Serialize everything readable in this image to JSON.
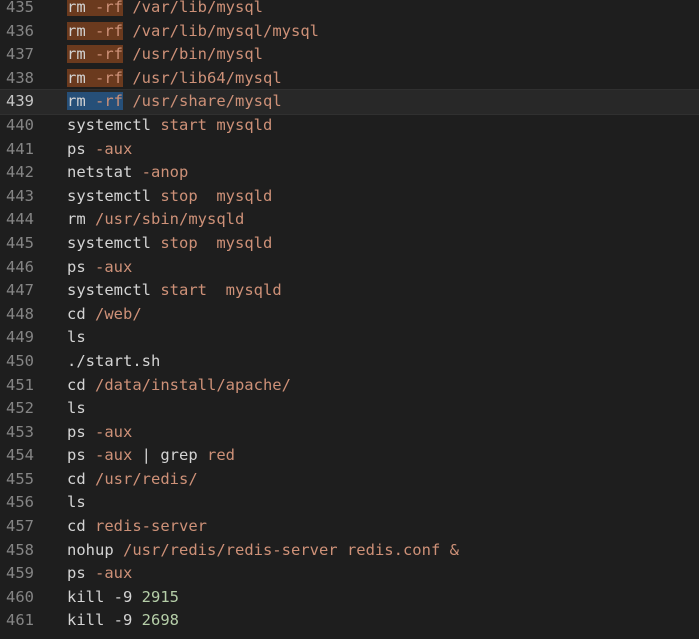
{
  "colors": {
    "background": "#1e1e1e",
    "line_number": "#858585",
    "command": "#d4d4d4",
    "argument": "#ce9178",
    "number": "#b5cea8",
    "selection_highlight": "#6b3a1e",
    "cursor_selection": "#264f78",
    "current_line": "#282828"
  },
  "editor": {
    "current_line": 439,
    "lines": [
      {
        "n": "435",
        "tokens": [
          {
            "t": "rm",
            "k": "cmd",
            "hl": true
          },
          {
            "t": " ",
            "k": "cmd",
            "hl": true
          },
          {
            "t": "-rf",
            "k": "arg",
            "hl": true
          },
          {
            "t": " /var/lib/mysql",
            "k": "arg"
          }
        ]
      },
      {
        "n": "436",
        "tokens": [
          {
            "t": "rm",
            "k": "cmd",
            "hl": true
          },
          {
            "t": " ",
            "k": "cmd",
            "hl": true
          },
          {
            "t": "-rf",
            "k": "arg",
            "hl": true
          },
          {
            "t": " /var/lib/mysql/mysql",
            "k": "arg"
          }
        ]
      },
      {
        "n": "437",
        "tokens": [
          {
            "t": "rm",
            "k": "cmd",
            "hl": true
          },
          {
            "t": " ",
            "k": "cmd",
            "hl": true
          },
          {
            "t": "-rf",
            "k": "arg",
            "hl": true
          },
          {
            "t": " /usr/bin/mysql",
            "k": "arg"
          }
        ]
      },
      {
        "n": "438",
        "tokens": [
          {
            "t": "rm",
            "k": "cmd",
            "hl": true
          },
          {
            "t": " ",
            "k": "cmd",
            "hl": true
          },
          {
            "t": "-rf",
            "k": "arg",
            "hl": true
          },
          {
            "t": " /usr/lib64/mysql",
            "k": "arg"
          }
        ]
      },
      {
        "n": "439",
        "tokens": [
          {
            "t": "rm",
            "k": "cmd",
            "cur": true
          },
          {
            "t": " ",
            "k": "cmd",
            "cur": true
          },
          {
            "t": "-rf",
            "k": "arg",
            "cur": true
          },
          {
            "t": " /usr/share/mysql",
            "k": "arg"
          }
        ]
      },
      {
        "n": "440",
        "tokens": [
          {
            "t": "systemctl",
            "k": "cmd"
          },
          {
            "t": " start mysqld",
            "k": "arg"
          }
        ]
      },
      {
        "n": "441",
        "tokens": [
          {
            "t": "ps",
            "k": "cmd"
          },
          {
            "t": " -aux",
            "k": "arg"
          }
        ]
      },
      {
        "n": "442",
        "tokens": [
          {
            "t": "netstat",
            "k": "cmd"
          },
          {
            "t": " -anop",
            "k": "arg"
          }
        ]
      },
      {
        "n": "443",
        "tokens": [
          {
            "t": "systemctl",
            "k": "cmd"
          },
          {
            "t": " stop  mysqld",
            "k": "arg"
          }
        ]
      },
      {
        "n": "444",
        "tokens": [
          {
            "t": "rm",
            "k": "cmd"
          },
          {
            "t": " /usr/sbin/mysqld",
            "k": "arg"
          }
        ]
      },
      {
        "n": "445",
        "tokens": [
          {
            "t": "systemctl",
            "k": "cmd"
          },
          {
            "t": " stop  mysqld",
            "k": "arg"
          }
        ]
      },
      {
        "n": "446",
        "tokens": [
          {
            "t": "ps",
            "k": "cmd"
          },
          {
            "t": " -aux",
            "k": "arg"
          }
        ]
      },
      {
        "n": "447",
        "tokens": [
          {
            "t": "systemctl",
            "k": "cmd"
          },
          {
            "t": " start  mysqld",
            "k": "arg"
          }
        ]
      },
      {
        "n": "448",
        "tokens": [
          {
            "t": "cd",
            "k": "cmd"
          },
          {
            "t": " /web/",
            "k": "arg"
          }
        ]
      },
      {
        "n": "449",
        "tokens": [
          {
            "t": "ls",
            "k": "cmd"
          }
        ]
      },
      {
        "n": "450",
        "tokens": [
          {
            "t": "./start.sh",
            "k": "cmd"
          }
        ]
      },
      {
        "n": "451",
        "tokens": [
          {
            "t": "cd",
            "k": "cmd"
          },
          {
            "t": " /data/install/apache/",
            "k": "arg"
          }
        ]
      },
      {
        "n": "452",
        "tokens": [
          {
            "t": "ls",
            "k": "cmd"
          }
        ]
      },
      {
        "n": "453",
        "tokens": [
          {
            "t": "ps",
            "k": "cmd"
          },
          {
            "t": " -aux",
            "k": "arg"
          }
        ]
      },
      {
        "n": "454",
        "tokens": [
          {
            "t": "ps",
            "k": "cmd"
          },
          {
            "t": " -aux",
            "k": "arg"
          },
          {
            "t": " | ",
            "k": "op"
          },
          {
            "t": "grep",
            "k": "cmd"
          },
          {
            "t": " red",
            "k": "arg"
          }
        ]
      },
      {
        "n": "455",
        "tokens": [
          {
            "t": "cd",
            "k": "cmd"
          },
          {
            "t": " /usr/redis/",
            "k": "arg"
          }
        ]
      },
      {
        "n": "456",
        "tokens": [
          {
            "t": "ls",
            "k": "cmd"
          }
        ]
      },
      {
        "n": "457",
        "tokens": [
          {
            "t": "cd",
            "k": "cmd"
          },
          {
            "t": " redis-server",
            "k": "arg"
          }
        ]
      },
      {
        "n": "458",
        "tokens": [
          {
            "t": "nohup",
            "k": "cmd"
          },
          {
            "t": " /usr/redis/redis-server redis.conf",
            "k": "arg"
          },
          {
            "t": " &",
            "k": "arg"
          }
        ]
      },
      {
        "n": "459",
        "tokens": [
          {
            "t": "ps",
            "k": "cmd"
          },
          {
            "t": " -aux",
            "k": "arg"
          }
        ]
      },
      {
        "n": "460",
        "tokens": [
          {
            "t": "kill",
            "k": "cmd"
          },
          {
            "t": " -9 ",
            "k": "cmd"
          },
          {
            "t": "2915",
            "k": "num"
          }
        ]
      },
      {
        "n": "461",
        "tokens": [
          {
            "t": "kill",
            "k": "cmd"
          },
          {
            "t": " -9 ",
            "k": "cmd"
          },
          {
            "t": "2698",
            "k": "num"
          }
        ]
      }
    ]
  }
}
